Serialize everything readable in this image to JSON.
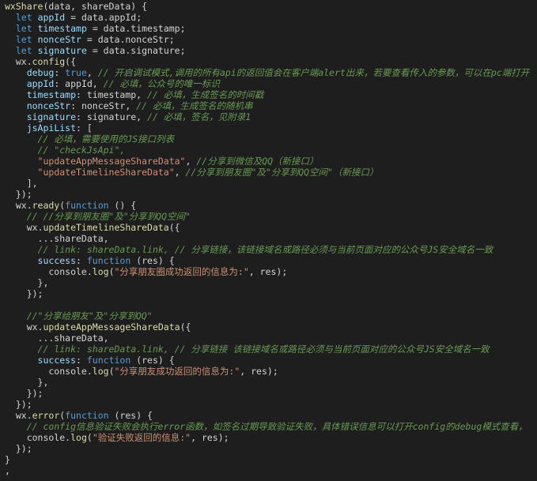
{
  "theme": {
    "background": "#1e1e1e",
    "keyword": "#569cd6",
    "function": "#dcdcaa",
    "variable": "#9cdcfe",
    "string": "#ce9178",
    "comment": "#6a9955",
    "text": "#d4d4d4"
  },
  "lines": [
    [
      [
        "fn",
        "wxShare"
      ],
      [
        "pn",
        "(data, shareData) {"
      ]
    ],
    [
      [
        "pn",
        "  "
      ],
      [
        "kw",
        "let"
      ],
      [
        "pn",
        " "
      ],
      [
        "var",
        "appId"
      ],
      [
        "pn",
        " = data.appId;"
      ]
    ],
    [
      [
        "pn",
        "  "
      ],
      [
        "kw",
        "let"
      ],
      [
        "pn",
        " "
      ],
      [
        "var",
        "timestamp"
      ],
      [
        "pn",
        " = data.timestamp;"
      ]
    ],
    [
      [
        "pn",
        "  "
      ],
      [
        "kw",
        "let"
      ],
      [
        "pn",
        " "
      ],
      [
        "var",
        "nonceStr"
      ],
      [
        "pn",
        " = data.nonceStr;"
      ]
    ],
    [
      [
        "pn",
        "  "
      ],
      [
        "kw",
        "let"
      ],
      [
        "pn",
        " "
      ],
      [
        "var",
        "signature"
      ],
      [
        "pn",
        " = data.signature;"
      ]
    ],
    [
      [
        "pn",
        "  wx."
      ],
      [
        "fn",
        "config"
      ],
      [
        "pn",
        "({"
      ]
    ],
    [
      [
        "pn",
        "    "
      ],
      [
        "prop",
        "debug"
      ],
      [
        "pn",
        ": "
      ],
      [
        "bool",
        "true"
      ],
      [
        "pn",
        ", "
      ],
      [
        "cm",
        "// 开启调试模式,调用的所有api的返回值会在客户端alert出来，若要查看传入的参数，可以在pc端打开"
      ]
    ],
    [
      [
        "pn",
        "    "
      ],
      [
        "prop",
        "appId"
      ],
      [
        "pn",
        ": appId, "
      ],
      [
        "cm",
        "// 必填，公众号的唯一标识"
      ]
    ],
    [
      [
        "pn",
        "    "
      ],
      [
        "prop",
        "timestamp"
      ],
      [
        "pn",
        ": timestamp, "
      ],
      [
        "cm",
        "// 必填，生成签名的时间戳"
      ]
    ],
    [
      [
        "pn",
        "    "
      ],
      [
        "prop",
        "nonceStr"
      ],
      [
        "pn",
        ": nonceStr, "
      ],
      [
        "cm",
        "// 必填，生成签名的随机串"
      ]
    ],
    [
      [
        "pn",
        "    "
      ],
      [
        "prop",
        "signature"
      ],
      [
        "pn",
        ": signature, "
      ],
      [
        "cm",
        "// 必填，签名，见附录1"
      ]
    ],
    [
      [
        "pn",
        "    "
      ],
      [
        "prop",
        "jsApiList"
      ],
      [
        "pn",
        ": ["
      ]
    ],
    [
      [
        "pn",
        "      "
      ],
      [
        "cm",
        "// 必填，需要使用的JS接口列表"
      ]
    ],
    [
      [
        "pn",
        "      "
      ],
      [
        "cm",
        "// \"checkJsApi\","
      ]
    ],
    [
      [
        "pn",
        "      "
      ],
      [
        "str",
        "\"updateAppMessageShareData\""
      ],
      [
        "pn",
        ", "
      ],
      [
        "cm",
        "//分享到微信及QQ（新接口）"
      ]
    ],
    [
      [
        "pn",
        "      "
      ],
      [
        "str",
        "\"updateTimelineShareData\""
      ],
      [
        "pn",
        ", "
      ],
      [
        "cm",
        "//分享到朋友圈\"及\"分享到QQ空间\"（新接口）"
      ]
    ],
    [
      [
        "pn",
        "    ],"
      ]
    ],
    [
      [
        "pn",
        "  });"
      ]
    ],
    [
      [
        "pn",
        "  wx."
      ],
      [
        "fn",
        "ready"
      ],
      [
        "pn",
        "("
      ],
      [
        "kw",
        "function"
      ],
      [
        "pn",
        " () {"
      ]
    ],
    [
      [
        "pn",
        "    "
      ],
      [
        "cm",
        "// //分享到朋友圈\"及\"分享到QQ空间\""
      ]
    ],
    [
      [
        "pn",
        "    wx."
      ],
      [
        "fn",
        "updateTimelineShareData"
      ],
      [
        "pn",
        "({"
      ]
    ],
    [
      [
        "pn",
        "      ...shareData,"
      ]
    ],
    [
      [
        "pn",
        "      "
      ],
      [
        "cm",
        "// link: shareData.link, // 分享链接，该链接域名或路径必须与当前页面对应的公众号JS安全域名一致"
      ]
    ],
    [
      [
        "pn",
        "      "
      ],
      [
        "prop",
        "success"
      ],
      [
        "pn",
        ": "
      ],
      [
        "kw",
        "function"
      ],
      [
        "pn",
        " (res) {"
      ]
    ],
    [
      [
        "pn",
        "        console."
      ],
      [
        "fn",
        "log"
      ],
      [
        "pn",
        "("
      ],
      [
        "str",
        "\"分享朋友圈成功返回的信息为:\""
      ],
      [
        "pn",
        ", res);"
      ]
    ],
    [
      [
        "pn",
        "      },"
      ]
    ],
    [
      [
        "pn",
        "    });"
      ]
    ],
    [
      [
        "pn",
        ""
      ]
    ],
    [
      [
        "pn",
        "    "
      ],
      [
        "cm",
        "//\"分享给朋友\"及\"分享到QQ\""
      ]
    ],
    [
      [
        "pn",
        "    wx."
      ],
      [
        "fn",
        "updateAppMessageShareData"
      ],
      [
        "pn",
        "({"
      ]
    ],
    [
      [
        "pn",
        "      ...shareData,"
      ]
    ],
    [
      [
        "pn",
        "      "
      ],
      [
        "cm",
        "// link: shareData.link, // 分享链接 该链接域名或路径必须与当前页面对应的公众号JS安全域名一致"
      ]
    ],
    [
      [
        "pn",
        "      "
      ],
      [
        "prop",
        "success"
      ],
      [
        "pn",
        ": "
      ],
      [
        "kw",
        "function"
      ],
      [
        "pn",
        " (res) {"
      ]
    ],
    [
      [
        "pn",
        "        console."
      ],
      [
        "fn",
        "log"
      ],
      [
        "pn",
        "("
      ],
      [
        "str",
        "\"分享朋友成功返回的信息为:\""
      ],
      [
        "pn",
        ", res);"
      ]
    ],
    [
      [
        "pn",
        "      },"
      ]
    ],
    [
      [
        "pn",
        "    });"
      ]
    ],
    [
      [
        "pn",
        "  });"
      ]
    ],
    [
      [
        "pn",
        "  wx."
      ],
      [
        "fn",
        "error"
      ],
      [
        "pn",
        "("
      ],
      [
        "kw",
        "function"
      ],
      [
        "pn",
        " (res) {"
      ]
    ],
    [
      [
        "pn",
        "    "
      ],
      [
        "cm",
        "// config信息验证失败会执行error函数，如签名过期导致验证失败，具体错误信息可以打开config的debug模式查看，"
      ]
    ],
    [
      [
        "pn",
        "    console."
      ],
      [
        "fn",
        "log"
      ],
      [
        "pn",
        "("
      ],
      [
        "str",
        "\"验证失败返回的信息:\""
      ],
      [
        "pn",
        ", res);"
      ]
    ],
    [
      [
        "pn",
        "  });"
      ]
    ],
    [
      [
        "pn",
        "}"
      ]
    ],
    [
      [
        "pn",
        ","
      ]
    ]
  ]
}
